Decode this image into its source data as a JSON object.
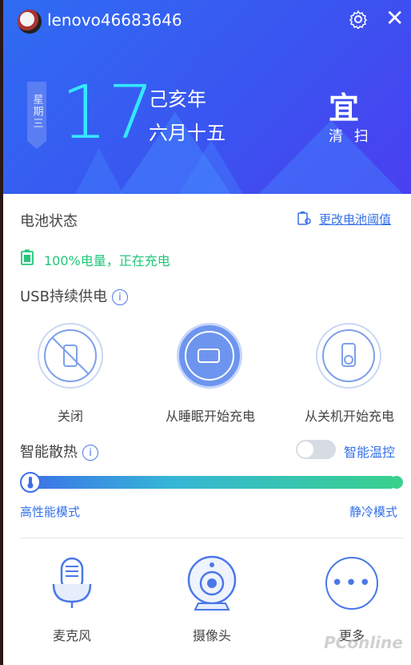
{
  "header": {
    "username": "lenovo46683646",
    "weekday": "星期三",
    "day": "17",
    "lunar_year": "己亥年",
    "lunar_date": "六月十五",
    "suitable": "宜",
    "suitable_item": "清 扫"
  },
  "battery": {
    "title": "电池状态",
    "change_threshold": "更改电池阈值",
    "status": "100%电量，正在充电"
  },
  "usb": {
    "title": "USB持续供电",
    "options": [
      {
        "label": "关闭",
        "selected": false
      },
      {
        "label": "从睡眠开始充电",
        "selected": true
      },
      {
        "label": "从关机开始充电",
        "selected": false
      }
    ]
  },
  "cooling": {
    "title": "智能散热",
    "toggle_label": "智能温控",
    "toggle_on": false,
    "mode_left": "高性能模式",
    "mode_right": "静冷模式",
    "level": 0.0
  },
  "bottom": {
    "items": [
      {
        "label": "麦克风",
        "icon": "microphone-icon"
      },
      {
        "label": "摄像头",
        "icon": "camera-icon"
      },
      {
        "label": "更多",
        "icon": "more-icon"
      }
    ]
  },
  "watermark": "PConline",
  "colors": {
    "accent": "#3470e8",
    "cyan": "#35e8ff",
    "green": "#21c779"
  }
}
